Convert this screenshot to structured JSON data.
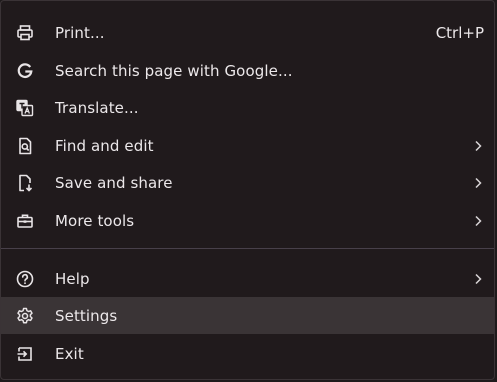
{
  "menu": {
    "items": [
      {
        "label": "Print...",
        "shortcut": "Ctrl+P",
        "icon": "printer-icon"
      },
      {
        "label": "Search this page with Google...",
        "icon": "google-icon"
      },
      {
        "label": "Translate...",
        "icon": "translate-icon"
      },
      {
        "label": "Find and edit",
        "icon": "find-in-page-icon",
        "submenu": true
      },
      {
        "label": "Save and share",
        "icon": "save-page-icon",
        "submenu": true
      },
      {
        "label": "More tools",
        "icon": "toolbox-icon",
        "submenu": true
      },
      {
        "label": "Help",
        "icon": "help-circle-icon",
        "submenu": true
      },
      {
        "label": "Settings",
        "icon": "gear-icon",
        "hovered": true
      },
      {
        "label": "Exit",
        "icon": "exit-icon"
      }
    ]
  },
  "colors": {
    "background": "#201a1c",
    "hover": "#3a3436",
    "text": "#ece8ea",
    "separator": "#48404a"
  }
}
